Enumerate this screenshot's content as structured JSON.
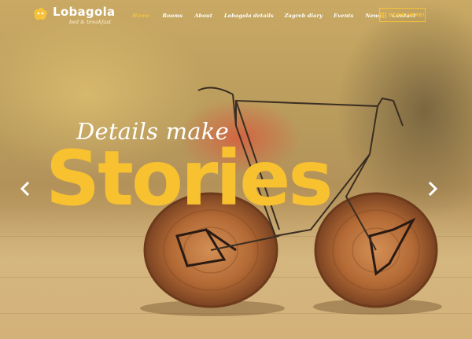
{
  "brand": {
    "name": "Lobagola",
    "tagline": "bed & breakfast"
  },
  "nav": {
    "items": [
      {
        "label": "Home",
        "active": true
      },
      {
        "label": "Rooms",
        "active": false
      },
      {
        "label": "About",
        "active": false
      },
      {
        "label": "Lobagola details",
        "active": false
      },
      {
        "label": "Zagreb diary",
        "active": false
      },
      {
        "label": "Events",
        "active": false
      },
      {
        "label": "News",
        "active": false
      },
      {
        "label": "Contact",
        "active": false
      }
    ]
  },
  "book_button": {
    "label": "BOOK HERE!",
    "icon": "grid-icon"
  },
  "hero": {
    "subtitle": "Details make",
    "headline": "Stories",
    "prev_icon": "chevron-left-icon",
    "next_icon": "chevron-right-icon"
  },
  "colors": {
    "accent": "#f5c23a",
    "headline": "#f7c130",
    "text": "#ffffff"
  }
}
